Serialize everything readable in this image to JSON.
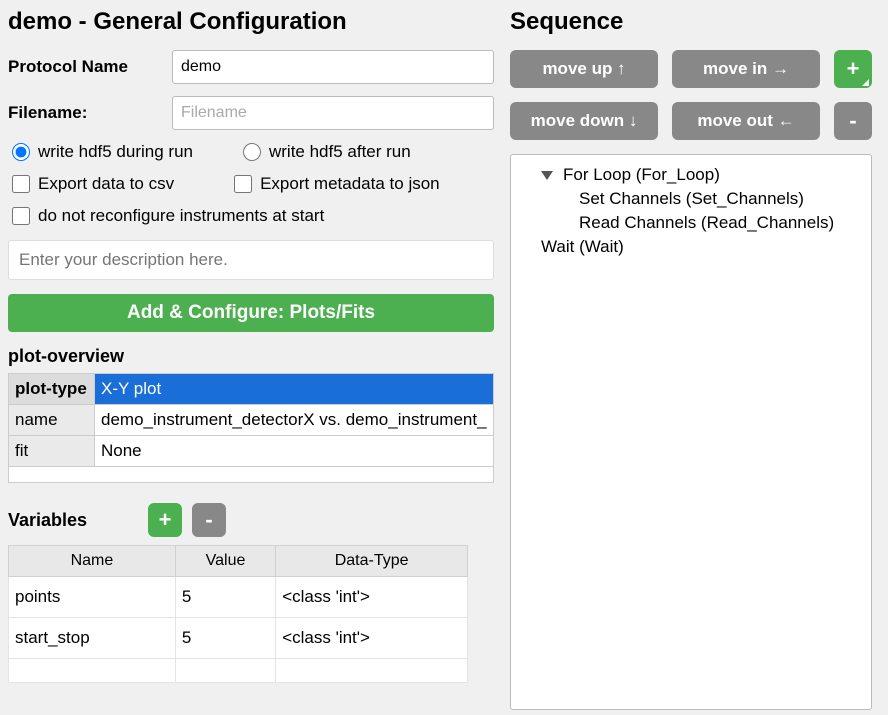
{
  "header": {
    "title": "demo - General Configuration"
  },
  "form": {
    "protocol_label": "Protocol Name",
    "protocol_value": "demo",
    "filename_label": "Filename:",
    "filename_placeholder": "Filename",
    "radio_during": "write hdf5 during run",
    "radio_after": "write hdf5 after run",
    "check_csv": "Export data to csv",
    "check_json": "Export metadata to json",
    "check_no_reconfig": "do not reconfigure instruments at start",
    "description_placeholder": "Enter your description here."
  },
  "add_configure_label": "Add & Configure: Plots/Fits",
  "plot_overview": {
    "heading": "plot-overview",
    "rows": [
      {
        "k": "plot-type",
        "v": "X-Y plot",
        "selected": true,
        "boldkey": true
      },
      {
        "k": "name",
        "v": "demo_instrument_detectorX vs. demo_instrument_"
      },
      {
        "k": "fit",
        "v": "None"
      }
    ]
  },
  "variables": {
    "heading": "Variables",
    "add_label": "+",
    "remove_label": "-",
    "columns": [
      "Name",
      "Value",
      "Data-Type"
    ],
    "rows": [
      {
        "name": "points",
        "value": "5",
        "type": "<class 'int'>"
      },
      {
        "name": "start_stop",
        "value": "5",
        "type": "<class 'int'>"
      }
    ]
  },
  "sequence": {
    "heading": "Sequence",
    "btn_move_up": "move up ↑",
    "btn_move_in": "move in →",
    "btn_move_down": "move down ↓",
    "btn_move_out": "move out ←",
    "btn_add": "+",
    "btn_remove": "-",
    "tree": [
      {
        "level": 1,
        "expandable": true,
        "label": "For Loop (For_Loop)"
      },
      {
        "level": 2,
        "label": "Set Channels (Set_Channels)"
      },
      {
        "level": 2,
        "label": "Read Channels (Read_Channels)"
      },
      {
        "level": 1,
        "label": "Wait (Wait)"
      }
    ]
  }
}
